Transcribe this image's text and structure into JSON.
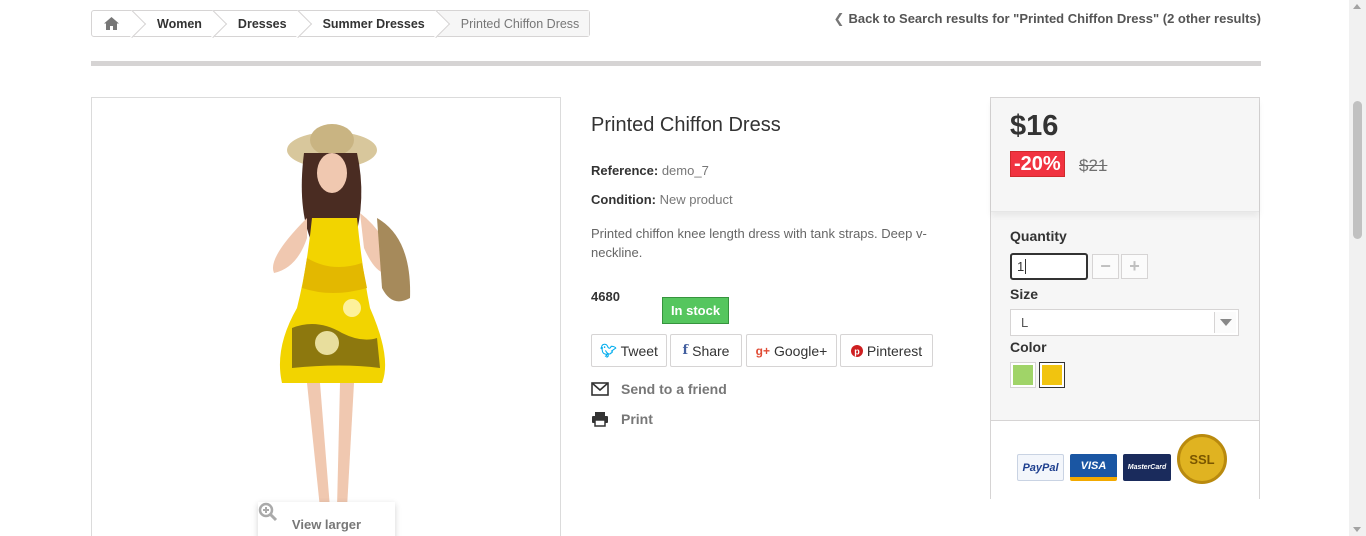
{
  "breadcrumb": {
    "home_icon": "home-icon",
    "items": [
      "Women",
      "Dresses",
      "Summer Dresses",
      "Printed Chiffon Dress"
    ]
  },
  "back_link": "Back to Search results for \"Printed Chiffon Dress\" (2 other results)",
  "image": {
    "view_larger": "View larger"
  },
  "product": {
    "name": "Printed Chiffon Dress",
    "reference_label": "Reference:",
    "reference_value": "demo_7",
    "condition_label": "Condition:",
    "condition_value": "New product",
    "description": "Printed chiffon knee length dress with tank straps. Deep v-neckline.",
    "quantity_available": "4680",
    "stock_status": "In stock"
  },
  "social": {
    "tweet": "Tweet",
    "share": "Share",
    "google": "Google+",
    "pinterest": "Pinterest"
  },
  "actions": {
    "send": "Send to a friend",
    "print": "Print"
  },
  "buy_box": {
    "price": "$16",
    "discount": "-20%",
    "old_price": "$21",
    "quantity_label": "Quantity",
    "quantity_value": "1",
    "minus": "−",
    "plus": "+",
    "size_label": "Size",
    "size_value": "L",
    "color_label": "Color",
    "colors": [
      "#a0d468",
      "#f1c40f"
    ],
    "selected_color_index": 1
  },
  "payment": {
    "paypal": "PayPal",
    "visa": "VISA",
    "mastercard": "MasterCard",
    "ssl": "SSL"
  },
  "colors": {
    "stock_green": "#55c65e",
    "discount_red": "#f13340",
    "twitter": "#00aced",
    "facebook": "#435f9f",
    "google": "#e04b34",
    "pinterest": "#ce1f21"
  }
}
